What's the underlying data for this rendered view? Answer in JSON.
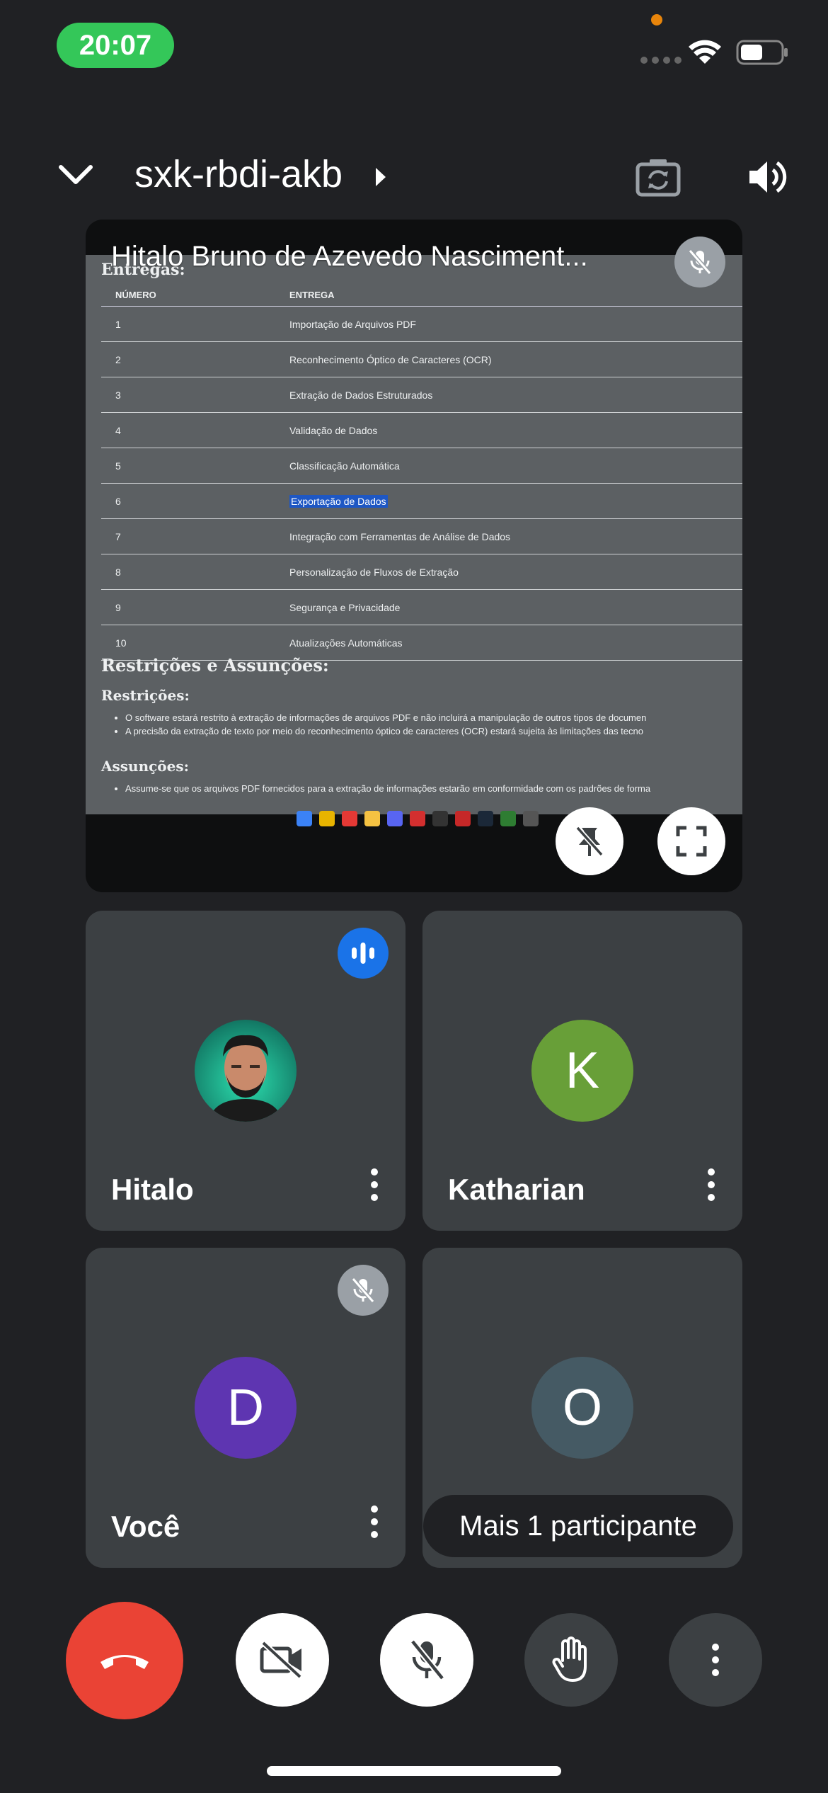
{
  "status_bar": {
    "time": "20:07"
  },
  "header": {
    "meeting_code": "sxk-rbdi-akb"
  },
  "presentation": {
    "presenter_name": "Hitalo Bruno de Azevedo Nasciment...",
    "doc": {
      "section_heading": "Entregas:",
      "table_headers": [
        "NÚMERO",
        "ENTREGA"
      ],
      "rows": [
        {
          "num": "1",
          "text": "Importação de Arquivos PDF"
        },
        {
          "num": "2",
          "text": "Reconhecimento Óptico de Caracteres (OCR)"
        },
        {
          "num": "3",
          "text": "Extração de Dados Estruturados"
        },
        {
          "num": "4",
          "text": "Validação de Dados"
        },
        {
          "num": "5",
          "text": "Classificação Automática"
        },
        {
          "num": "6",
          "text": "Exportação de Dados"
        },
        {
          "num": "7",
          "text": "Integração com Ferramentas de Análise de Dados"
        },
        {
          "num": "8",
          "text": "Personalização de Fluxos de Extração"
        },
        {
          "num": "9",
          "text": "Segurança e Privacidade"
        },
        {
          "num": "10",
          "text": "Atualizações Automáticas"
        }
      ],
      "restrictions_heading": "Restrições e Assunções:",
      "restrictions_sub": "Restrições:",
      "restriction_items": [
        "O software estará restrito à extração de informações de arquivos PDF e não incluirá a manipulação de outros tipos de documen",
        "A precisão da extração de texto por meio do reconhecimento óptico de caracteres (OCR) estará sujeita às limitações das tecno"
      ],
      "assumptions_sub": "Assunções:",
      "assumption_items": [
        "Assume-se que os arquivos PDF fornecidos para a extração de informações estarão em conformidade com os padrões de forma"
      ]
    }
  },
  "participants": [
    {
      "name": "Hitalo",
      "speaking": true
    },
    {
      "name": "Katharian",
      "initial": "K",
      "color": "#689f38"
    },
    {
      "name": "Você",
      "initial": "D",
      "color": "#5e35b1",
      "muted": true
    },
    {
      "initial": "O",
      "color": "#455a64",
      "more_label": "Mais 1 participante"
    }
  ],
  "colors": {
    "end_call": "#ea4335",
    "speaking": "#1a73e8",
    "background": "#202124",
    "tile": "#3c4043"
  },
  "icons": [
    "chevron-down-icon",
    "play-arrow-icon",
    "flip-camera-icon",
    "speaker-icon",
    "mic-off-icon",
    "unpin-icon",
    "fullscreen-icon",
    "audio-wave-icon",
    "more-vert-icon",
    "end-call-icon",
    "camera-off-icon",
    "hand-raise-icon"
  ]
}
